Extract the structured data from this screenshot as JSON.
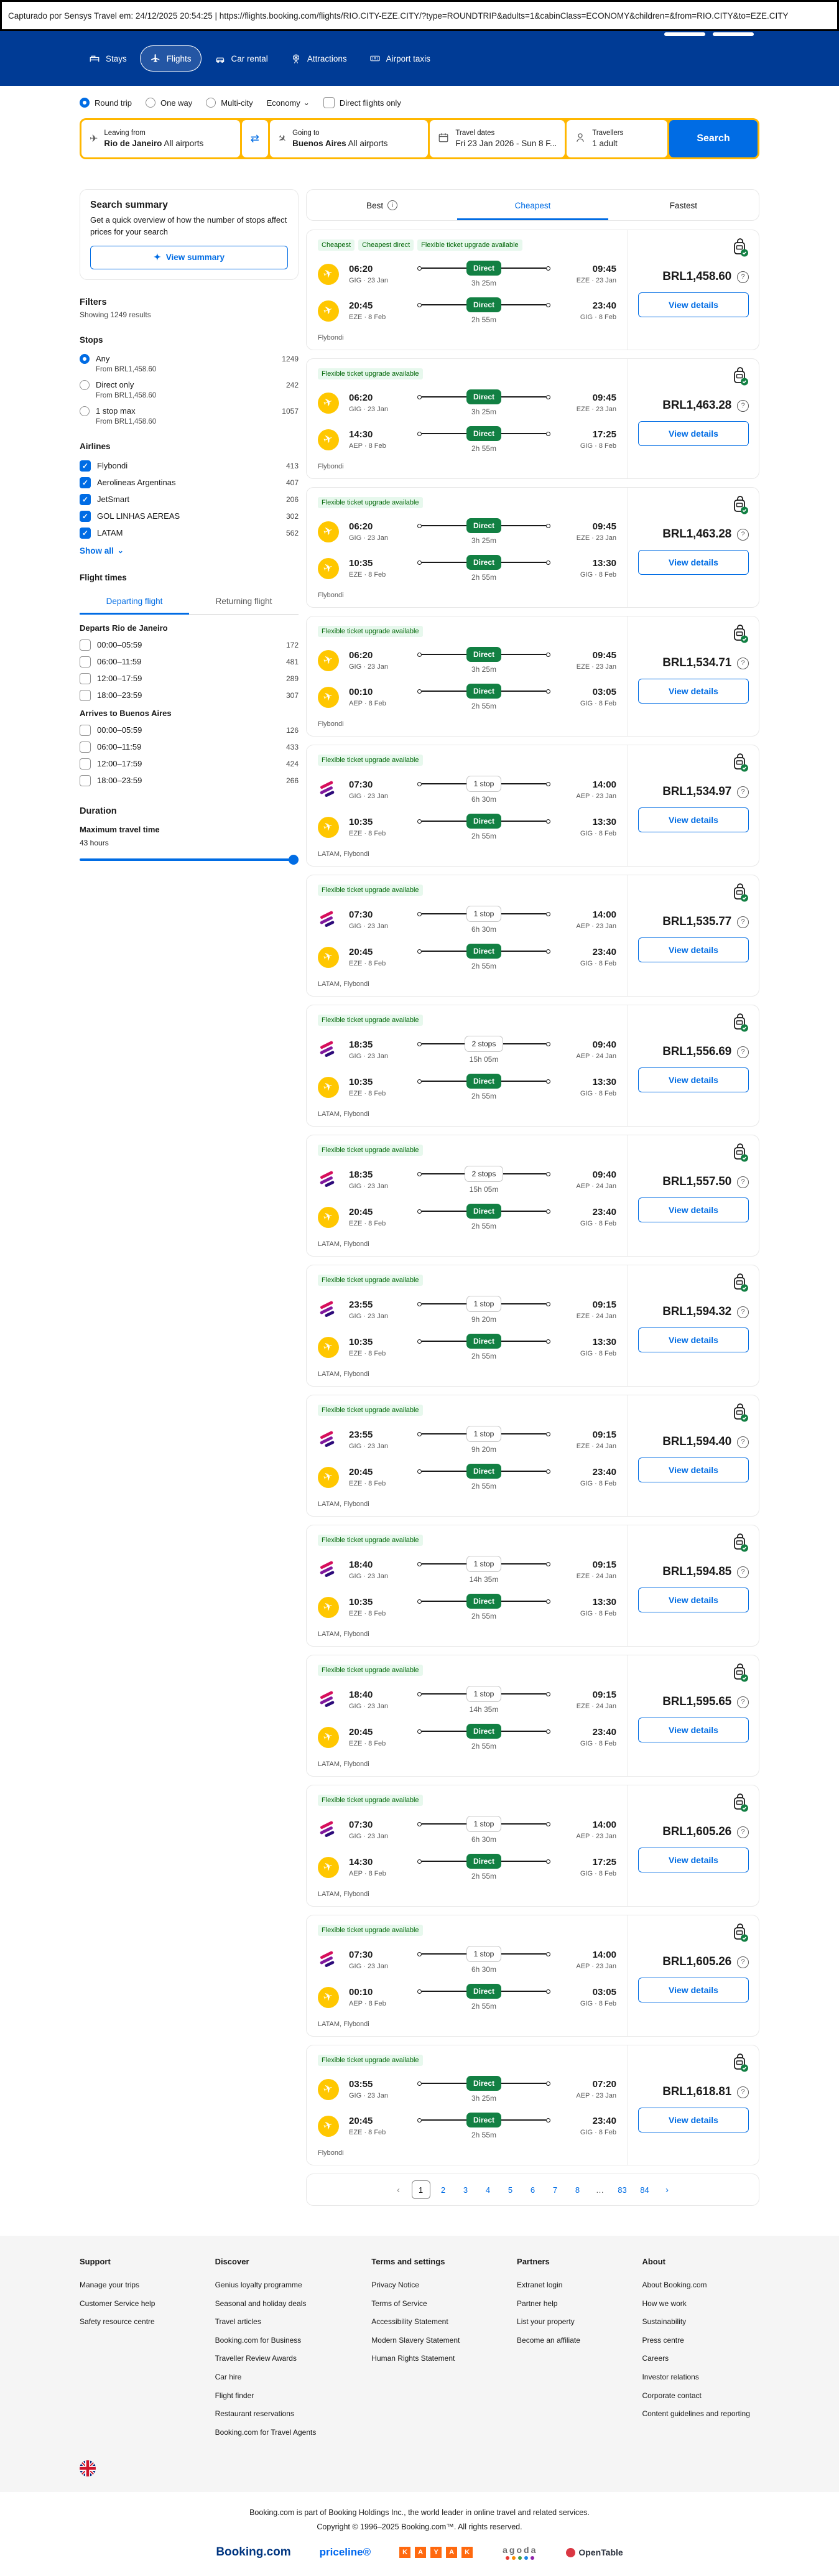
{
  "capture_bar": {
    "text": "Capturado por Sensys Travel em: 24/12/2025 20:54:25  |  https://flights.booking.com/flights/RIO.CITY-EZE.CITY/?type=ROUNDTRIP&adults=1&cabinClass=ECONOMY&children=&from=RIO.CITY&to=EZE.CITY"
  },
  "colors": {
    "header_blue": "#003b95",
    "accent_blue": "#006ce4",
    "search_yellow": "#ffb700",
    "direct_green": "#128043",
    "badge_green_bg": "#e7f8ed",
    "badge_green_text": "#006607"
  },
  "header": {
    "nav": [
      {
        "label": "Stays",
        "icon": "bed",
        "active": false
      },
      {
        "label": "Flights",
        "icon": "plane",
        "active": true
      },
      {
        "label": "Car rental",
        "icon": "car",
        "active": false
      },
      {
        "label": "Attractions",
        "icon": "attraction",
        "active": false
      },
      {
        "label": "Airport taxis",
        "icon": "taxi",
        "active": false
      }
    ]
  },
  "search": {
    "trip_types": [
      {
        "label": "Round trip",
        "selected": true
      },
      {
        "label": "One way",
        "selected": false
      },
      {
        "label": "Multi-city",
        "selected": false
      }
    ],
    "cabin_class": "Economy",
    "direct_only_label": "Direct flights only",
    "fields": {
      "from": {
        "label": "Leaving from",
        "value_bold": "Rio de Janeiro",
        "value_rest": "All airports"
      },
      "to": {
        "label": "Going to",
        "value_bold": "Buenos Aires",
        "value_rest": "All airports"
      },
      "dates": {
        "label": "Travel dates",
        "value": "Fri 23 Jan 2026 - Sun 8 F..."
      },
      "travellers": {
        "label": "Travellers",
        "value": "1 adult"
      }
    },
    "search_button": "Search"
  },
  "sidebar": {
    "summary": {
      "title": "Search summary",
      "description": "Get a quick overview of how the number of stops affect prices for your search",
      "button": "View summary"
    },
    "filters_title": "Filters",
    "results_count": "Showing 1249 results",
    "stops_title": "Stops",
    "stops": [
      {
        "label": "Any",
        "count": "1249",
        "sub": "From BRL1,458.60",
        "selected": true
      },
      {
        "label": "Direct only",
        "count": "242",
        "sub": "From BRL1,458.60",
        "selected": false
      },
      {
        "label": "1 stop max",
        "count": "1057",
        "sub": "From BRL1,458.60",
        "selected": false
      }
    ],
    "airlines_title": "Airlines",
    "airlines": [
      {
        "label": "Flybondi",
        "count": "413",
        "checked": true
      },
      {
        "label": "Aerolineas Argentinas",
        "count": "407",
        "checked": true
      },
      {
        "label": "JetSmart",
        "count": "206",
        "checked": true
      },
      {
        "label": "GOL LINHAS AEREAS",
        "count": "302",
        "checked": true
      },
      {
        "label": "LATAM",
        "count": "562",
        "checked": true
      }
    ],
    "show_all": "Show all",
    "flight_times_title": "Flight times",
    "time_tabs": [
      {
        "label": "Departing flight",
        "active": true
      },
      {
        "label": "Returning flight",
        "active": false
      }
    ],
    "time_groups": [
      {
        "title": "Departs Rio de Janeiro",
        "options": [
          {
            "label": "00:00–05:59",
            "count": "172",
            "checked": false
          },
          {
            "label": "06:00–11:59",
            "count": "481",
            "checked": false
          },
          {
            "label": "12:00–17:59",
            "count": "289",
            "checked": false
          },
          {
            "label": "18:00–23:59",
            "count": "307",
            "checked": false
          }
        ]
      },
      {
        "title": "Arrives to Buenos Aires",
        "options": [
          {
            "label": "00:00–05:59",
            "count": "126",
            "checked": false
          },
          {
            "label": "06:00–11:59",
            "count": "433",
            "checked": false
          },
          {
            "label": "12:00–17:59",
            "count": "424",
            "checked": false
          },
          {
            "label": "18:00–23:59",
            "count": "266",
            "checked": false
          }
        ]
      }
    ],
    "duration_title": "Duration",
    "duration_subtitle": "Maximum travel time",
    "duration_value": "43 hours"
  },
  "results": {
    "tabs": [
      {
        "label": "Best",
        "info": true,
        "active": false
      },
      {
        "label": "Cheapest",
        "info": false,
        "active": true
      },
      {
        "label": "Fastest",
        "info": false,
        "active": false
      }
    ],
    "view_details_label": "View details",
    "cards": [
      {
        "badges": [
          "Cheapest",
          "Cheapest direct",
          "Flexible ticket upgrade available"
        ],
        "legs": [
          {
            "airline": "flybondi",
            "dep_time": "06:20",
            "dep_meta": "GIG · 23 Jan",
            "stop": "Direct",
            "stop_type": "direct",
            "duration": "3h 25m",
            "arr_time": "09:45",
            "arr_meta": "EZE · 23 Jan"
          },
          {
            "airline": "flybondi",
            "dep_time": "20:45",
            "dep_meta": "EZE · 8 Feb",
            "stop": "Direct",
            "stop_type": "direct",
            "duration": "2h 55m",
            "arr_time": "23:40",
            "arr_meta": "GIG · 8 Feb"
          }
        ],
        "airlines_label": "Flybondi",
        "price": "BRL1,458.60"
      },
      {
        "badges": [
          "Flexible ticket upgrade available"
        ],
        "legs": [
          {
            "airline": "flybondi",
            "dep_time": "06:20",
            "dep_meta": "GIG · 23 Jan",
            "stop": "Direct",
            "stop_type": "direct",
            "duration": "3h 25m",
            "arr_time": "09:45",
            "arr_meta": "EZE · 23 Jan"
          },
          {
            "airline": "flybondi",
            "dep_time": "14:30",
            "dep_meta": "AEP · 8 Feb",
            "stop": "Direct",
            "stop_type": "direct",
            "duration": "2h 55m",
            "arr_time": "17:25",
            "arr_meta": "GIG · 8 Feb"
          }
        ],
        "airlines_label": "Flybondi",
        "price": "BRL1,463.28"
      },
      {
        "badges": [
          "Flexible ticket upgrade available"
        ],
        "legs": [
          {
            "airline": "flybondi",
            "dep_time": "06:20",
            "dep_meta": "GIG · 23 Jan",
            "stop": "Direct",
            "stop_type": "direct",
            "duration": "3h 25m",
            "arr_time": "09:45",
            "arr_meta": "EZE · 23 Jan"
          },
          {
            "airline": "flybondi",
            "dep_time": "10:35",
            "dep_meta": "EZE · 8 Feb",
            "stop": "Direct",
            "stop_type": "direct",
            "duration": "2h 55m",
            "arr_time": "13:30",
            "arr_meta": "GIG · 8 Feb"
          }
        ],
        "airlines_label": "Flybondi",
        "price": "BRL1,463.28"
      },
      {
        "badges": [
          "Flexible ticket upgrade available"
        ],
        "legs": [
          {
            "airline": "flybondi",
            "dep_time": "06:20",
            "dep_meta": "GIG · 23 Jan",
            "stop": "Direct",
            "stop_type": "direct",
            "duration": "3h 25m",
            "arr_time": "09:45",
            "arr_meta": "EZE · 23 Jan"
          },
          {
            "airline": "flybondi",
            "dep_time": "00:10",
            "dep_meta": "AEP · 8 Feb",
            "stop": "Direct",
            "stop_type": "direct",
            "duration": "2h 55m",
            "arr_time": "03:05",
            "arr_meta": "GIG · 8 Feb"
          }
        ],
        "airlines_label": "Flybondi",
        "price": "BRL1,534.71"
      },
      {
        "badges": [
          "Flexible ticket upgrade available"
        ],
        "legs": [
          {
            "airline": "latam",
            "dep_time": "07:30",
            "dep_meta": "GIG · 23 Jan",
            "stop": "1 stop",
            "stop_type": "stops",
            "duration": "6h 30m",
            "arr_time": "14:00",
            "arr_meta": "AEP · 23 Jan"
          },
          {
            "airline": "flybondi",
            "dep_time": "10:35",
            "dep_meta": "EZE · 8 Feb",
            "stop": "Direct",
            "stop_type": "direct",
            "duration": "2h 55m",
            "arr_time": "13:30",
            "arr_meta": "GIG · 8 Feb"
          }
        ],
        "airlines_label": "LATAM, Flybondi",
        "price": "BRL1,534.97"
      },
      {
        "badges": [
          "Flexible ticket upgrade available"
        ],
        "legs": [
          {
            "airline": "latam",
            "dep_time": "07:30",
            "dep_meta": "GIG · 23 Jan",
            "stop": "1 stop",
            "stop_type": "stops",
            "duration": "6h 30m",
            "arr_time": "14:00",
            "arr_meta": "AEP · 23 Jan"
          },
          {
            "airline": "flybondi",
            "dep_time": "20:45",
            "dep_meta": "EZE · 8 Feb",
            "stop": "Direct",
            "stop_type": "direct",
            "duration": "2h 55m",
            "arr_time": "23:40",
            "arr_meta": "GIG · 8 Feb"
          }
        ],
        "airlines_label": "LATAM, Flybondi",
        "price": "BRL1,535.77"
      },
      {
        "badges": [
          "Flexible ticket upgrade available"
        ],
        "legs": [
          {
            "airline": "latam",
            "dep_time": "18:35",
            "dep_meta": "GIG · 23 Jan",
            "stop": "2 stops",
            "stop_type": "stops",
            "duration": "15h 05m",
            "arr_time": "09:40",
            "arr_meta": "AEP · 24 Jan"
          },
          {
            "airline": "flybondi",
            "dep_time": "10:35",
            "dep_meta": "EZE · 8 Feb",
            "stop": "Direct",
            "stop_type": "direct",
            "duration": "2h 55m",
            "arr_time": "13:30",
            "arr_meta": "GIG · 8 Feb"
          }
        ],
        "airlines_label": "LATAM, Flybondi",
        "price": "BRL1,556.69"
      },
      {
        "badges": [
          "Flexible ticket upgrade available"
        ],
        "legs": [
          {
            "airline": "latam",
            "dep_time": "18:35",
            "dep_meta": "GIG · 23 Jan",
            "stop": "2 stops",
            "stop_type": "stops",
            "duration": "15h 05m",
            "arr_time": "09:40",
            "arr_meta": "AEP · 24 Jan"
          },
          {
            "airline": "flybondi",
            "dep_time": "20:45",
            "dep_meta": "EZE · 8 Feb",
            "stop": "Direct",
            "stop_type": "direct",
            "duration": "2h 55m",
            "arr_time": "23:40",
            "arr_meta": "GIG · 8 Feb"
          }
        ],
        "airlines_label": "LATAM, Flybondi",
        "price": "BRL1,557.50"
      },
      {
        "badges": [
          "Flexible ticket upgrade available"
        ],
        "legs": [
          {
            "airline": "latam",
            "dep_time": "23:55",
            "dep_meta": "GIG · 23 Jan",
            "stop": "1 stop",
            "stop_type": "stops",
            "duration": "9h 20m",
            "arr_time": "09:15",
            "arr_meta": "EZE · 24 Jan"
          },
          {
            "airline": "flybondi",
            "dep_time": "10:35",
            "dep_meta": "EZE · 8 Feb",
            "stop": "Direct",
            "stop_type": "direct",
            "duration": "2h 55m",
            "arr_time": "13:30",
            "arr_meta": "GIG · 8 Feb"
          }
        ],
        "airlines_label": "LATAM, Flybondi",
        "price": "BRL1,594.32"
      },
      {
        "badges": [
          "Flexible ticket upgrade available"
        ],
        "legs": [
          {
            "airline": "latam",
            "dep_time": "23:55",
            "dep_meta": "GIG · 23 Jan",
            "stop": "1 stop",
            "stop_type": "stops",
            "duration": "9h 20m",
            "arr_time": "09:15",
            "arr_meta": "EZE · 24 Jan"
          },
          {
            "airline": "flybondi",
            "dep_time": "20:45",
            "dep_meta": "EZE · 8 Feb",
            "stop": "Direct",
            "stop_type": "direct",
            "duration": "2h 55m",
            "arr_time": "23:40",
            "arr_meta": "GIG · 8 Feb"
          }
        ],
        "airlines_label": "LATAM, Flybondi",
        "price": "BRL1,594.40"
      },
      {
        "badges": [
          "Flexible ticket upgrade available"
        ],
        "legs": [
          {
            "airline": "latam",
            "dep_time": "18:40",
            "dep_meta": "GIG · 23 Jan",
            "stop": "1 stop",
            "stop_type": "stops",
            "duration": "14h 35m",
            "arr_time": "09:15",
            "arr_meta": "EZE · 24 Jan"
          },
          {
            "airline": "flybondi",
            "dep_time": "10:35",
            "dep_meta": "EZE · 8 Feb",
            "stop": "Direct",
            "stop_type": "direct",
            "duration": "2h 55m",
            "arr_time": "13:30",
            "arr_meta": "GIG · 8 Feb"
          }
        ],
        "airlines_label": "LATAM, Flybondi",
        "price": "BRL1,594.85"
      },
      {
        "badges": [
          "Flexible ticket upgrade available"
        ],
        "legs": [
          {
            "airline": "latam",
            "dep_time": "18:40",
            "dep_meta": "GIG · 23 Jan",
            "stop": "1 stop",
            "stop_type": "stops",
            "duration": "14h 35m",
            "arr_time": "09:15",
            "arr_meta": "EZE · 24 Jan"
          },
          {
            "airline": "flybondi",
            "dep_time": "20:45",
            "dep_meta": "EZE · 8 Feb",
            "stop": "Direct",
            "stop_type": "direct",
            "duration": "2h 55m",
            "arr_time": "23:40",
            "arr_meta": "GIG · 8 Feb"
          }
        ],
        "airlines_label": "LATAM, Flybondi",
        "price": "BRL1,595.65"
      },
      {
        "badges": [
          "Flexible ticket upgrade available"
        ],
        "legs": [
          {
            "airline": "latam",
            "dep_time": "07:30",
            "dep_meta": "GIG · 23 Jan",
            "stop": "1 stop",
            "stop_type": "stops",
            "duration": "6h 30m",
            "arr_time": "14:00",
            "arr_meta": "AEP · 23 Jan"
          },
          {
            "airline": "flybondi",
            "dep_time": "14:30",
            "dep_meta": "AEP · 8 Feb",
            "stop": "Direct",
            "stop_type": "direct",
            "duration": "2h 55m",
            "arr_time": "17:25",
            "arr_meta": "GIG · 8 Feb"
          }
        ],
        "airlines_label": "LATAM, Flybondi",
        "price": "BRL1,605.26"
      },
      {
        "badges": [
          "Flexible ticket upgrade available"
        ],
        "legs": [
          {
            "airline": "latam",
            "dep_time": "07:30",
            "dep_meta": "GIG · 23 Jan",
            "stop": "1 stop",
            "stop_type": "stops",
            "duration": "6h 30m",
            "arr_time": "14:00",
            "arr_meta": "AEP · 23 Jan"
          },
          {
            "airline": "flybondi",
            "dep_time": "00:10",
            "dep_meta": "AEP · 8 Feb",
            "stop": "Direct",
            "stop_type": "direct",
            "duration": "2h 55m",
            "arr_time": "03:05",
            "arr_meta": "GIG · 8 Feb"
          }
        ],
        "airlines_label": "LATAM, Flybondi",
        "price": "BRL1,605.26"
      },
      {
        "badges": [
          "Flexible ticket upgrade available"
        ],
        "legs": [
          {
            "airline": "flybondi",
            "dep_time": "03:55",
            "dep_meta": "GIG · 23 Jan",
            "stop": "Direct",
            "stop_type": "direct",
            "duration": "3h 25m",
            "arr_time": "07:20",
            "arr_meta": "AEP · 23 Jan"
          },
          {
            "airline": "flybondi",
            "dep_time": "20:45",
            "dep_meta": "EZE · 8 Feb",
            "stop": "Direct",
            "stop_type": "direct",
            "duration": "2h 55m",
            "arr_time": "23:40",
            "arr_meta": "GIG · 8 Feb"
          }
        ],
        "airlines_label": "Flybondi",
        "price": "BRL1,618.81"
      }
    ],
    "pagination": {
      "prev": "‹",
      "next": "›",
      "current": "1",
      "pages": [
        "1",
        "2",
        "3",
        "4",
        "5",
        "6",
        "7",
        "8",
        "…",
        "83",
        "84"
      ]
    }
  },
  "footer": {
    "columns": [
      {
        "title": "Support",
        "links": [
          "Manage your trips",
          "Customer Service help",
          "Safety resource centre"
        ]
      },
      {
        "title": "Discover",
        "links": [
          "Genius loyalty programme",
          "Seasonal and holiday deals",
          "Travel articles",
          "Booking.com for Business",
          "Traveller Review Awards",
          "Car hire",
          "Flight finder",
          "Restaurant reservations",
          "Booking.com for Travel Agents"
        ]
      },
      {
        "title": "Terms and settings",
        "links": [
          "Privacy Notice",
          "Terms of Service",
          "Accessibility Statement",
          "Modern Slavery Statement",
          "Human Rights Statement"
        ]
      },
      {
        "title": "Partners",
        "links": [
          "Extranet login",
          "Partner help",
          "List your property",
          "Become an affiliate"
        ]
      },
      {
        "title": "About",
        "links": [
          "About Booking.com",
          "How we work",
          "Sustainability",
          "Press centre",
          "Careers",
          "Investor relations",
          "Corporate contact",
          "Content guidelines and reporting"
        ]
      }
    ],
    "legal_line1": "Booking.com is part of Booking Holdings Inc., the world leader in online travel and related services.",
    "legal_line2": "Copyright © 1996–2025 Booking.com™. All rights reserved.",
    "brands": [
      "Booking.com",
      "priceline",
      "KAYAK",
      "agoda",
      "OpenTable"
    ]
  }
}
